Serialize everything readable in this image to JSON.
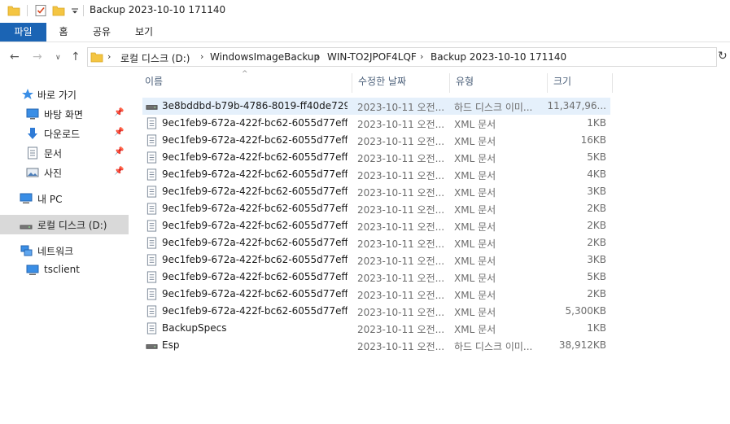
{
  "window": {
    "title": "Backup 2023-10-10 171140"
  },
  "ribbon": {
    "tabs": [
      "파일",
      "홈",
      "공유",
      "보기"
    ]
  },
  "address": {
    "crumbs": [
      "로컬 디스크 (D:)",
      "WindowsImageBackup",
      "WIN-TO2JPOF4LQF",
      "Backup 2023-10-10 171140"
    ]
  },
  "nav": {
    "quick_access": "바로 가기",
    "desktop": "바탕 화면",
    "downloads": "다운로드",
    "documents": "문서",
    "pictures": "사진",
    "this_pc": "내 PC",
    "local_disk": "로컬 디스크 (D:)",
    "network": "네트워크",
    "tsclient": "tsclient"
  },
  "columns": {
    "name": "이름",
    "date": "수정한 날짜",
    "type": "유형",
    "size": "크기"
  },
  "files": [
    {
      "name": "3e8bddbd-b79b-4786-8019-ff40de729...",
      "date": "2023-10-11 오전...",
      "type": "하드 디스크 이미...",
      "size": "11,347,96...",
      "icon": "disk-image-icon",
      "selected": true
    },
    {
      "name": "9ec1feb9-672a-422f-bc62-6055d77eff...",
      "date": "2023-10-11 오전...",
      "type": "XML 문서",
      "size": "1KB",
      "icon": "xml-document-icon"
    },
    {
      "name": "9ec1feb9-672a-422f-bc62-6055d77eff...",
      "date": "2023-10-11 오전...",
      "type": "XML 문서",
      "size": "16KB",
      "icon": "xml-document-icon"
    },
    {
      "name": "9ec1feb9-672a-422f-bc62-6055d77eff...",
      "date": "2023-10-11 오전...",
      "type": "XML 문서",
      "size": "5KB",
      "icon": "xml-document-icon"
    },
    {
      "name": "9ec1feb9-672a-422f-bc62-6055d77eff...",
      "date": "2023-10-11 오전...",
      "type": "XML 문서",
      "size": "4KB",
      "icon": "xml-document-icon"
    },
    {
      "name": "9ec1feb9-672a-422f-bc62-6055d77eff...",
      "date": "2023-10-11 오전...",
      "type": "XML 문서",
      "size": "3KB",
      "icon": "xml-document-icon"
    },
    {
      "name": "9ec1feb9-672a-422f-bc62-6055d77eff...",
      "date": "2023-10-11 오전...",
      "type": "XML 문서",
      "size": "2KB",
      "icon": "xml-document-icon"
    },
    {
      "name": "9ec1feb9-672a-422f-bc62-6055d77eff...",
      "date": "2023-10-11 오전...",
      "type": "XML 문서",
      "size": "2KB",
      "icon": "xml-document-icon"
    },
    {
      "name": "9ec1feb9-672a-422f-bc62-6055d77eff...",
      "date": "2023-10-11 오전...",
      "type": "XML 문서",
      "size": "2KB",
      "icon": "xml-document-icon"
    },
    {
      "name": "9ec1feb9-672a-422f-bc62-6055d77eff...",
      "date": "2023-10-11 오전...",
      "type": "XML 문서",
      "size": "3KB",
      "icon": "xml-document-icon"
    },
    {
      "name": "9ec1feb9-672a-422f-bc62-6055d77eff...",
      "date": "2023-10-11 오전...",
      "type": "XML 문서",
      "size": "5KB",
      "icon": "xml-document-icon"
    },
    {
      "name": "9ec1feb9-672a-422f-bc62-6055d77eff...",
      "date": "2023-10-11 오전...",
      "type": "XML 문서",
      "size": "2KB",
      "icon": "xml-document-icon"
    },
    {
      "name": "9ec1feb9-672a-422f-bc62-6055d77eff...",
      "date": "2023-10-11 오전...",
      "type": "XML 문서",
      "size": "5,300KB",
      "icon": "xml-document-icon"
    },
    {
      "name": "BackupSpecs",
      "date": "2023-10-11 오전...",
      "type": "XML 문서",
      "size": "1KB",
      "icon": "xml-document-icon"
    },
    {
      "name": "Esp",
      "date": "2023-10-11 오전...",
      "type": "하드 디스크 이미...",
      "size": "38,912KB",
      "icon": "disk-image-icon"
    }
  ],
  "colors": {
    "accent": "#1b64b4",
    "selection": "#e5f0fb",
    "nav_selected": "#d9d9d9",
    "folder": "#f4c542"
  }
}
